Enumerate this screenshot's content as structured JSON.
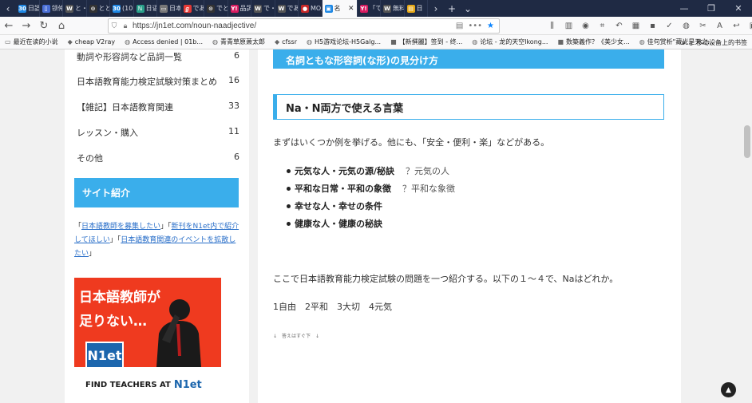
{
  "browser": {
    "tabs": [
      {
        "label": "日語教",
        "color": "#1e88e5",
        "glyph": "30"
      },
      {
        "label": "领仲中",
        "color": "#4a6fd6",
        "glyph": "▯"
      },
      {
        "label": "と・ら",
        "color": "#555555",
        "glyph": "W"
      },
      {
        "label": "ととこ",
        "color": "#333333",
        "glyph": "⊙"
      },
      {
        "label": "(10 新",
        "color": "#1e88e5",
        "glyph": "30"
      },
      {
        "label": "日语n",
        "color": "#2aa08a",
        "glyph": "ℕ"
      },
      {
        "label": "日本語",
        "color": "#777777",
        "glyph": "▭"
      },
      {
        "label": "である",
        "color": "#e53935",
        "glyph": "ℊ"
      },
      {
        "label": "でとな",
        "color": "#333333",
        "glyph": "⊙"
      },
      {
        "label": "品詞別",
        "color": "#d81b60",
        "glyph": "Y!"
      },
      {
        "label": "で・",
        "color": "#555555",
        "glyph": "W"
      },
      {
        "label": "である",
        "color": "#555555",
        "glyph": "W"
      },
      {
        "label": "MO用",
        "color": "#c62828",
        "glyph": "●"
      },
      {
        "label": "名",
        "color": "#1e88e5",
        "glyph": "▣",
        "active": true
      },
      {
        "label": "「で」",
        "color": "#d81b60",
        "glyph": "Y!"
      },
      {
        "label": "無料で",
        "color": "#555555",
        "glyph": "W"
      },
      {
        "label": "日",
        "color": "#e6a817",
        "glyph": "▤"
      }
    ],
    "url": "https://jn1et.com/noun-naadjective/",
    "bookmarks": [
      "最近在读的小说",
      "cheap V2ray",
      "Access denied | 01b...",
      "青青草原萧太郎",
      "cfssr",
      "H5游戏论坛-H5Galg...",
      "【新撰麗】签到 - 终...",
      "论坛 - 龙的天空lkong...",
      "数築義作？《美少女...",
      "佳句赏析\"藏光是天之...",
      "移动设备上的书签"
    ]
  },
  "sidebar": {
    "categories": [
      {
        "name": "動詞や形容詞など品詞一覧",
        "count": "6"
      },
      {
        "name": "日本語教育能力検定試験対策まとめ",
        "count": "16"
      },
      {
        "name": "【雑記】日本語教育関連",
        "count": "33"
      },
      {
        "name": "レッスン・購入",
        "count": "11"
      },
      {
        "name": "その他",
        "count": "6"
      }
    ],
    "widget_title": "サイト紹介",
    "links": {
      "q1": "「",
      "l1": "日本語教師を募集したい",
      "q2": "」「",
      "l2": "新刊をN1et内で紹介してほしい",
      "q3": "」「",
      "l3": "日本語教育関連のイベントを拡散したい",
      "q4": "」"
    },
    "banner": {
      "line1": "日本語教師が",
      "line2": "足りない…",
      "logo": "N1et",
      "bottom_text": "FIND TEACHERS AT",
      "bottom_logo": "N1et"
    }
  },
  "article": {
    "top_heading": "名詞ともな形容詞(な形)の見分け方",
    "section_heading": "Na・N両方で使える言葉",
    "intro": "まずはいくつか例を挙げる。他にも、「安全・便利・楽」などがある。",
    "bullets": [
      {
        "bold": "元気な人・元気の源/秘訣",
        "note": "？元気の人"
      },
      {
        "bold": "平和な日常・平和の象徴",
        "note": "？平和な象徴"
      },
      {
        "bold": "幸せな人・幸せの条件",
        "note": ""
      },
      {
        "bold": "健康な人・健康の秘訣",
        "note": ""
      }
    ],
    "question": "ここで日本語教育能力検定試験の問題を一つ紹介する。以下の１～４で、Naはどれか。",
    "options": "1自由　2平和　3大切　4元気",
    "answer_note": "↓　答えはすぐ下　↓"
  },
  "icons": {
    "back": "back-arrow-icon",
    "forward": "forward-arrow-icon",
    "reload": "reload-icon",
    "home": "home-icon"
  }
}
